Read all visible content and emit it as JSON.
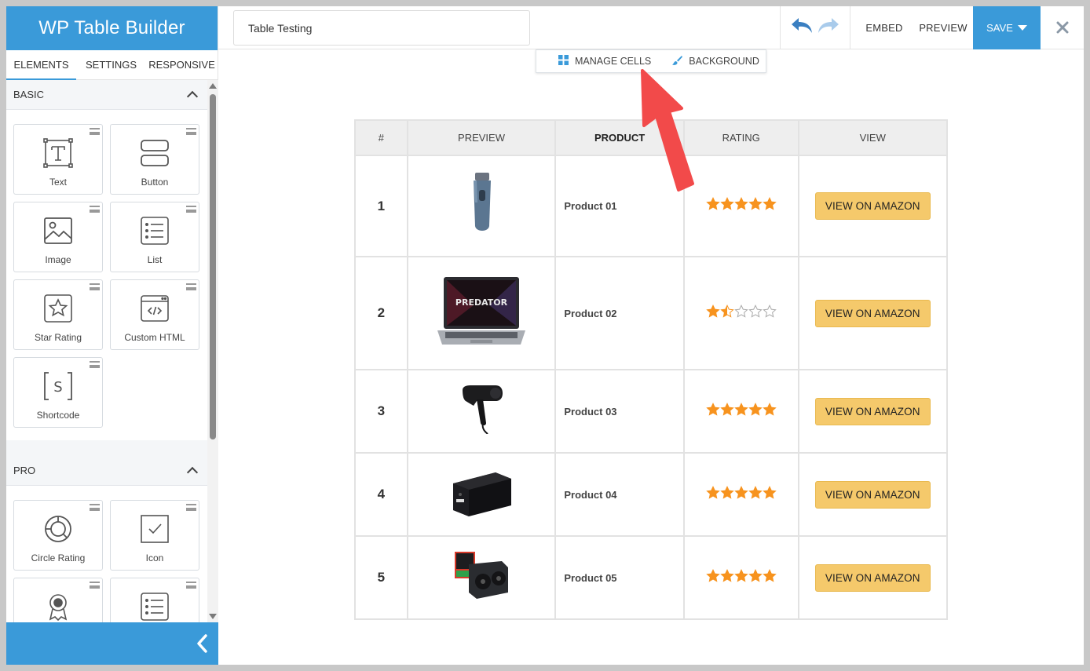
{
  "app": {
    "brand": "WP Table Builder",
    "accent": "#3a9ad9"
  },
  "sidebar": {
    "tabs": [
      {
        "label": "ELEMENTS",
        "active": true
      },
      {
        "label": "SETTINGS",
        "active": false
      },
      {
        "label": "RESPONSIVE",
        "active": false
      }
    ],
    "sections": {
      "basic": {
        "title": "BASIC",
        "items": [
          {
            "label": "Text",
            "icon": "text-icon"
          },
          {
            "label": "Button",
            "icon": "button-icon"
          },
          {
            "label": "Image",
            "icon": "image-icon"
          },
          {
            "label": "List",
            "icon": "list-icon"
          },
          {
            "label": "Star Rating",
            "icon": "star-icon"
          },
          {
            "label": "Custom HTML",
            "icon": "code-icon"
          },
          {
            "label": "Shortcode",
            "icon": "shortcode-icon"
          }
        ]
      },
      "pro": {
        "title": "PRO",
        "items": [
          {
            "label": "Circle Rating",
            "icon": "circle-rating-icon"
          },
          {
            "label": "Icon",
            "icon": "checkbox-icon"
          },
          {
            "label": "",
            "icon": "badge-icon"
          },
          {
            "label": "",
            "icon": "list-icon"
          }
        ]
      }
    }
  },
  "topbar": {
    "table_title": "Table Testing",
    "embed_label": "EMBED",
    "preview_label": "PREVIEW",
    "save_label": "SAVE"
  },
  "cell_toolbar": {
    "manage_cells_label": "MANAGE CELLS",
    "background_label": "BACKGROUND"
  },
  "table": {
    "headers": [
      "#",
      "PREVIEW",
      "PRODUCT",
      "RATING",
      "VIEW"
    ],
    "rows": [
      {
        "num": "1",
        "image": "hair-trimmer",
        "product": "Product 01",
        "rating": 5,
        "button": "VIEW ON AMAZON"
      },
      {
        "num": "2",
        "image": "laptop",
        "product": "Product 02",
        "rating": 1.5,
        "button": "VIEW ON AMAZON"
      },
      {
        "num": "3",
        "image": "hair-dryer",
        "product": "Product 03",
        "rating": 5,
        "button": "VIEW ON AMAZON"
      },
      {
        "num": "4",
        "image": "ups-battery",
        "product": "Product 04",
        "rating": 5,
        "button": "VIEW ON AMAZON"
      },
      {
        "num": "5",
        "image": "graphics-card",
        "product": "Product 05",
        "rating": 5,
        "button": "VIEW ON AMAZON"
      }
    ],
    "star_color": "#f7931e",
    "button_color": "#f5c96b"
  }
}
